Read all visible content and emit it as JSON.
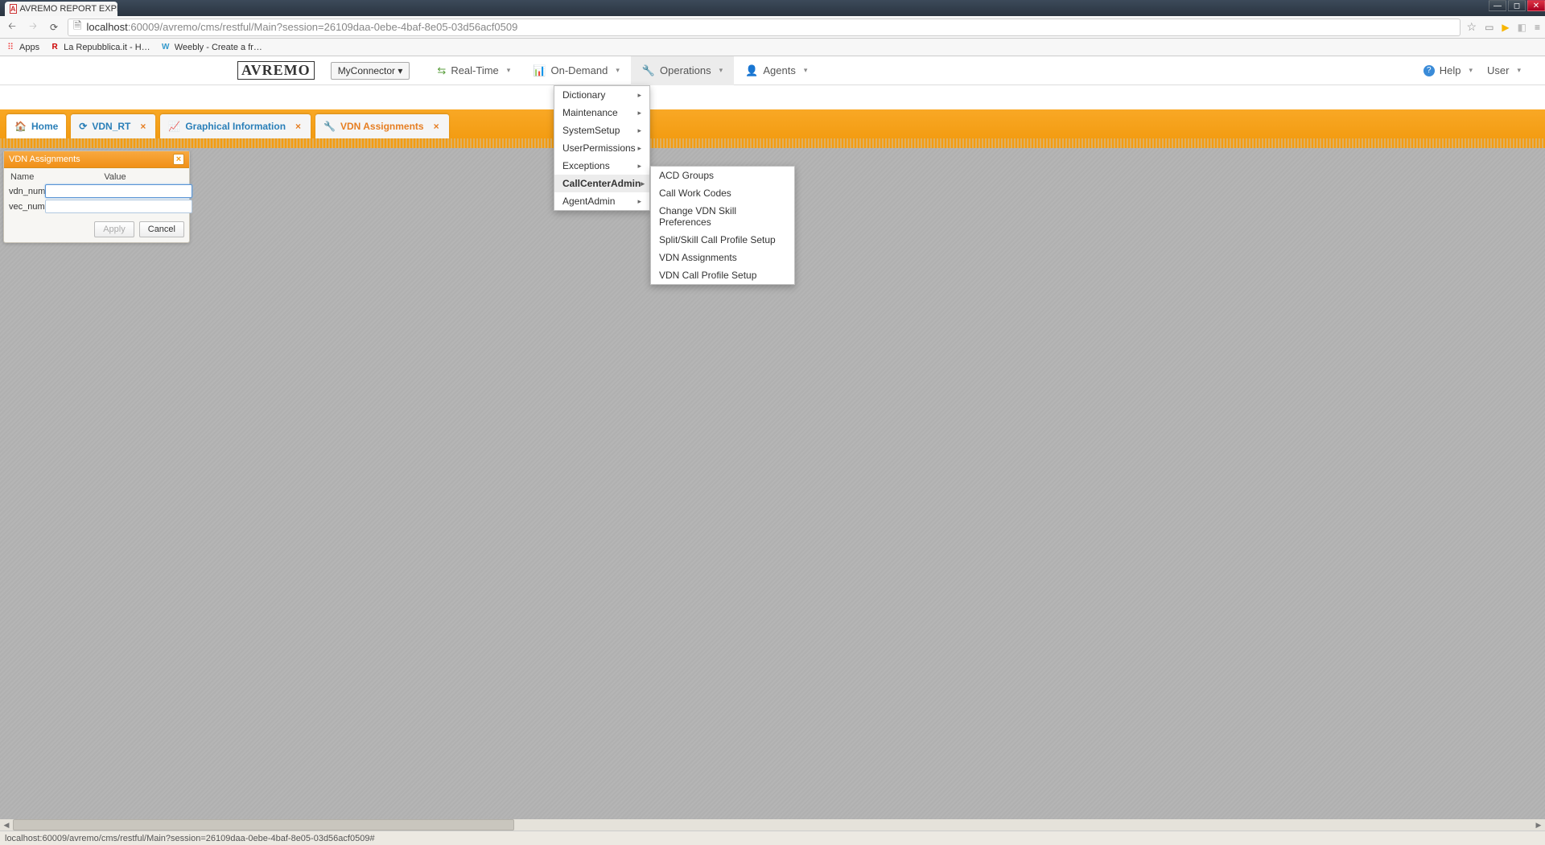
{
  "browser": {
    "tab_title": "AVREMO REPORT EXPLOR",
    "tab_icon_letter": "A",
    "url_prefix": "localhost",
    "url_rest": ":60009/avremo/cms/restful/Main?session=26109daa-0ebe-4baf-8e05-03d56acf0509",
    "bookmarks": [
      {
        "label": "Apps",
        "icon": "⠿"
      },
      {
        "label": "La Repubblica.it - H…",
        "icon": "R"
      },
      {
        "label": "Weebly - Create a fr…",
        "icon": "W"
      }
    ]
  },
  "topnav": {
    "logo": "AVREMO",
    "connector": "MyConnector ▾",
    "items": [
      {
        "label": "Real-Time",
        "icon": "↻"
      },
      {
        "label": "On-Demand",
        "icon": "▮"
      },
      {
        "label": "Operations",
        "icon": "🔧",
        "active": true
      },
      {
        "label": "Agents",
        "icon": "👤"
      }
    ],
    "right": [
      {
        "label": "Help",
        "icon": "?"
      },
      {
        "label": "User",
        "icon": ""
      }
    ]
  },
  "tabs": [
    {
      "label": "Home",
      "icon": "home",
      "home": true
    },
    {
      "label": "VDN_RT",
      "icon": "refresh"
    },
    {
      "label": "Graphical Information",
      "icon": "chart"
    },
    {
      "label": "VDN Assignments",
      "icon": "wrench",
      "active": true
    }
  ],
  "panel": {
    "title": "VDN Assignments",
    "columns": {
      "name": "Name",
      "value": "Value"
    },
    "rows": [
      {
        "name": "vdn_num",
        "value": ""
      },
      {
        "name": "vec_num",
        "value": ""
      }
    ],
    "buttons": {
      "apply": "Apply",
      "cancel": "Cancel"
    }
  },
  "operations_menu": [
    "Dictionary",
    "Maintenance",
    "SystemSetup",
    "UserPermissions",
    "Exceptions",
    "CallCenterAdmin",
    "AgentAdmin"
  ],
  "callcenter_submenu": [
    "ACD Groups",
    "Call Work Codes",
    "Change VDN Skill Preferences",
    "Split/Skill Call Profile Setup",
    "VDN Assignments",
    "VDN Call Profile Setup"
  ],
  "status_text": "localhost:60009/avremo/cms/restful/Main?session=26109daa-0ebe-4baf-8e05-03d56acf0509#"
}
